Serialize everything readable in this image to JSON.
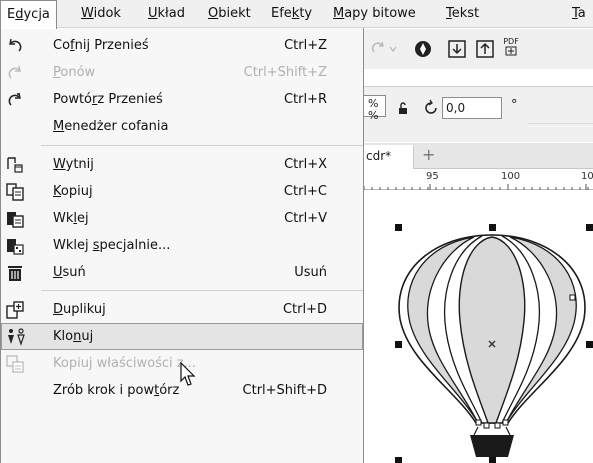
{
  "menubar": {
    "items": [
      {
        "pre": "E",
        "u": "d",
        "post": "ycja",
        "active": true
      },
      {
        "pre": "",
        "u": "W",
        "post": "idok",
        "active": false
      },
      {
        "pre": "",
        "u": "U",
        "post": "kład",
        "active": false
      },
      {
        "pre": "",
        "u": "O",
        "post": "biekt",
        "active": false
      },
      {
        "pre": "Efe",
        "u": "k",
        "post": "ty",
        "active": false
      },
      {
        "pre": "",
        "u": "M",
        "post": "apy bitowe",
        "active": false
      },
      {
        "pre": "",
        "u": "T",
        "post": "ekst",
        "active": false
      },
      {
        "pre": "",
        "u": "T",
        "post": "a",
        "active": false
      }
    ]
  },
  "menu": {
    "items": [
      {
        "pre": "Co",
        "u": "f",
        "post": "nij Przenieś",
        "shortcut": "Ctrl+Z",
        "icon": "undo-icon",
        "disabled": false
      },
      {
        "pre": "",
        "u": "P",
        "post": "onów",
        "shortcut": "Ctrl+Shift+Z",
        "icon": "redo-icon",
        "disabled": true
      },
      {
        "pre": "Powtó",
        "u": "r",
        "post": "z Przenieś",
        "shortcut": "Ctrl+R",
        "icon": "repeat-icon",
        "disabled": false
      },
      {
        "pre": "",
        "u": "M",
        "post": "enedżer cofania",
        "shortcut": "",
        "icon": "",
        "disabled": false
      },
      {
        "pre": "",
        "u": "W",
        "post": "ytnij",
        "shortcut": "Ctrl+X",
        "icon": "cut-icon",
        "disabled": false
      },
      {
        "pre": "",
        "u": "K",
        "post": "opiuj",
        "shortcut": "Ctrl+C",
        "icon": "copy-icon",
        "disabled": false
      },
      {
        "pre": "Wk",
        "u": "l",
        "post": "ej",
        "shortcut": "Ctrl+V",
        "icon": "paste-icon",
        "disabled": false
      },
      {
        "pre": "Wklej ",
        "u": "s",
        "post": "pecjalnie...",
        "shortcut": "",
        "icon": "paste-special-icon",
        "disabled": false
      },
      {
        "pre": "",
        "u": "U",
        "post": "suń",
        "shortcut": "Usuń",
        "icon": "trash-icon",
        "disabled": false
      },
      {
        "pre": "",
        "u": "D",
        "post": "uplikuj",
        "shortcut": "Ctrl+D",
        "icon": "duplicate-icon",
        "disabled": false
      },
      {
        "pre": "Klo",
        "u": "n",
        "post": "uj",
        "shortcut": "",
        "icon": "clone-icon",
        "disabled": false
      },
      {
        "pre": "Kopiuj właściwości z...",
        "u": "",
        "post": "",
        "shortcut": "",
        "icon": "copy-properties-icon",
        "disabled": true
      },
      {
        "pre": "Zrób krok i pow",
        "u": "t",
        "post": "órz",
        "shortcut": "Ctrl+Shift+D",
        "icon": "",
        "disabled": false
      }
    ]
  },
  "toolbar": {
    "pdf_label": "PDF",
    "percent_1": "%",
    "percent_2": "%",
    "angle_value": "0,0",
    "degree": "°"
  },
  "document": {
    "tab_label": "cdr*",
    "add_tab": "+"
  },
  "ruler": {
    "ticks": [
      "95",
      "100",
      "10"
    ]
  },
  "colors": {
    "balloon_fill": "#d9d9d9",
    "balloon_stroke": "#1a1a1a",
    "basket": "#1a1a1a",
    "menu_bg": "#f7f7f7",
    "hover_bg": "#e4e4e4"
  }
}
